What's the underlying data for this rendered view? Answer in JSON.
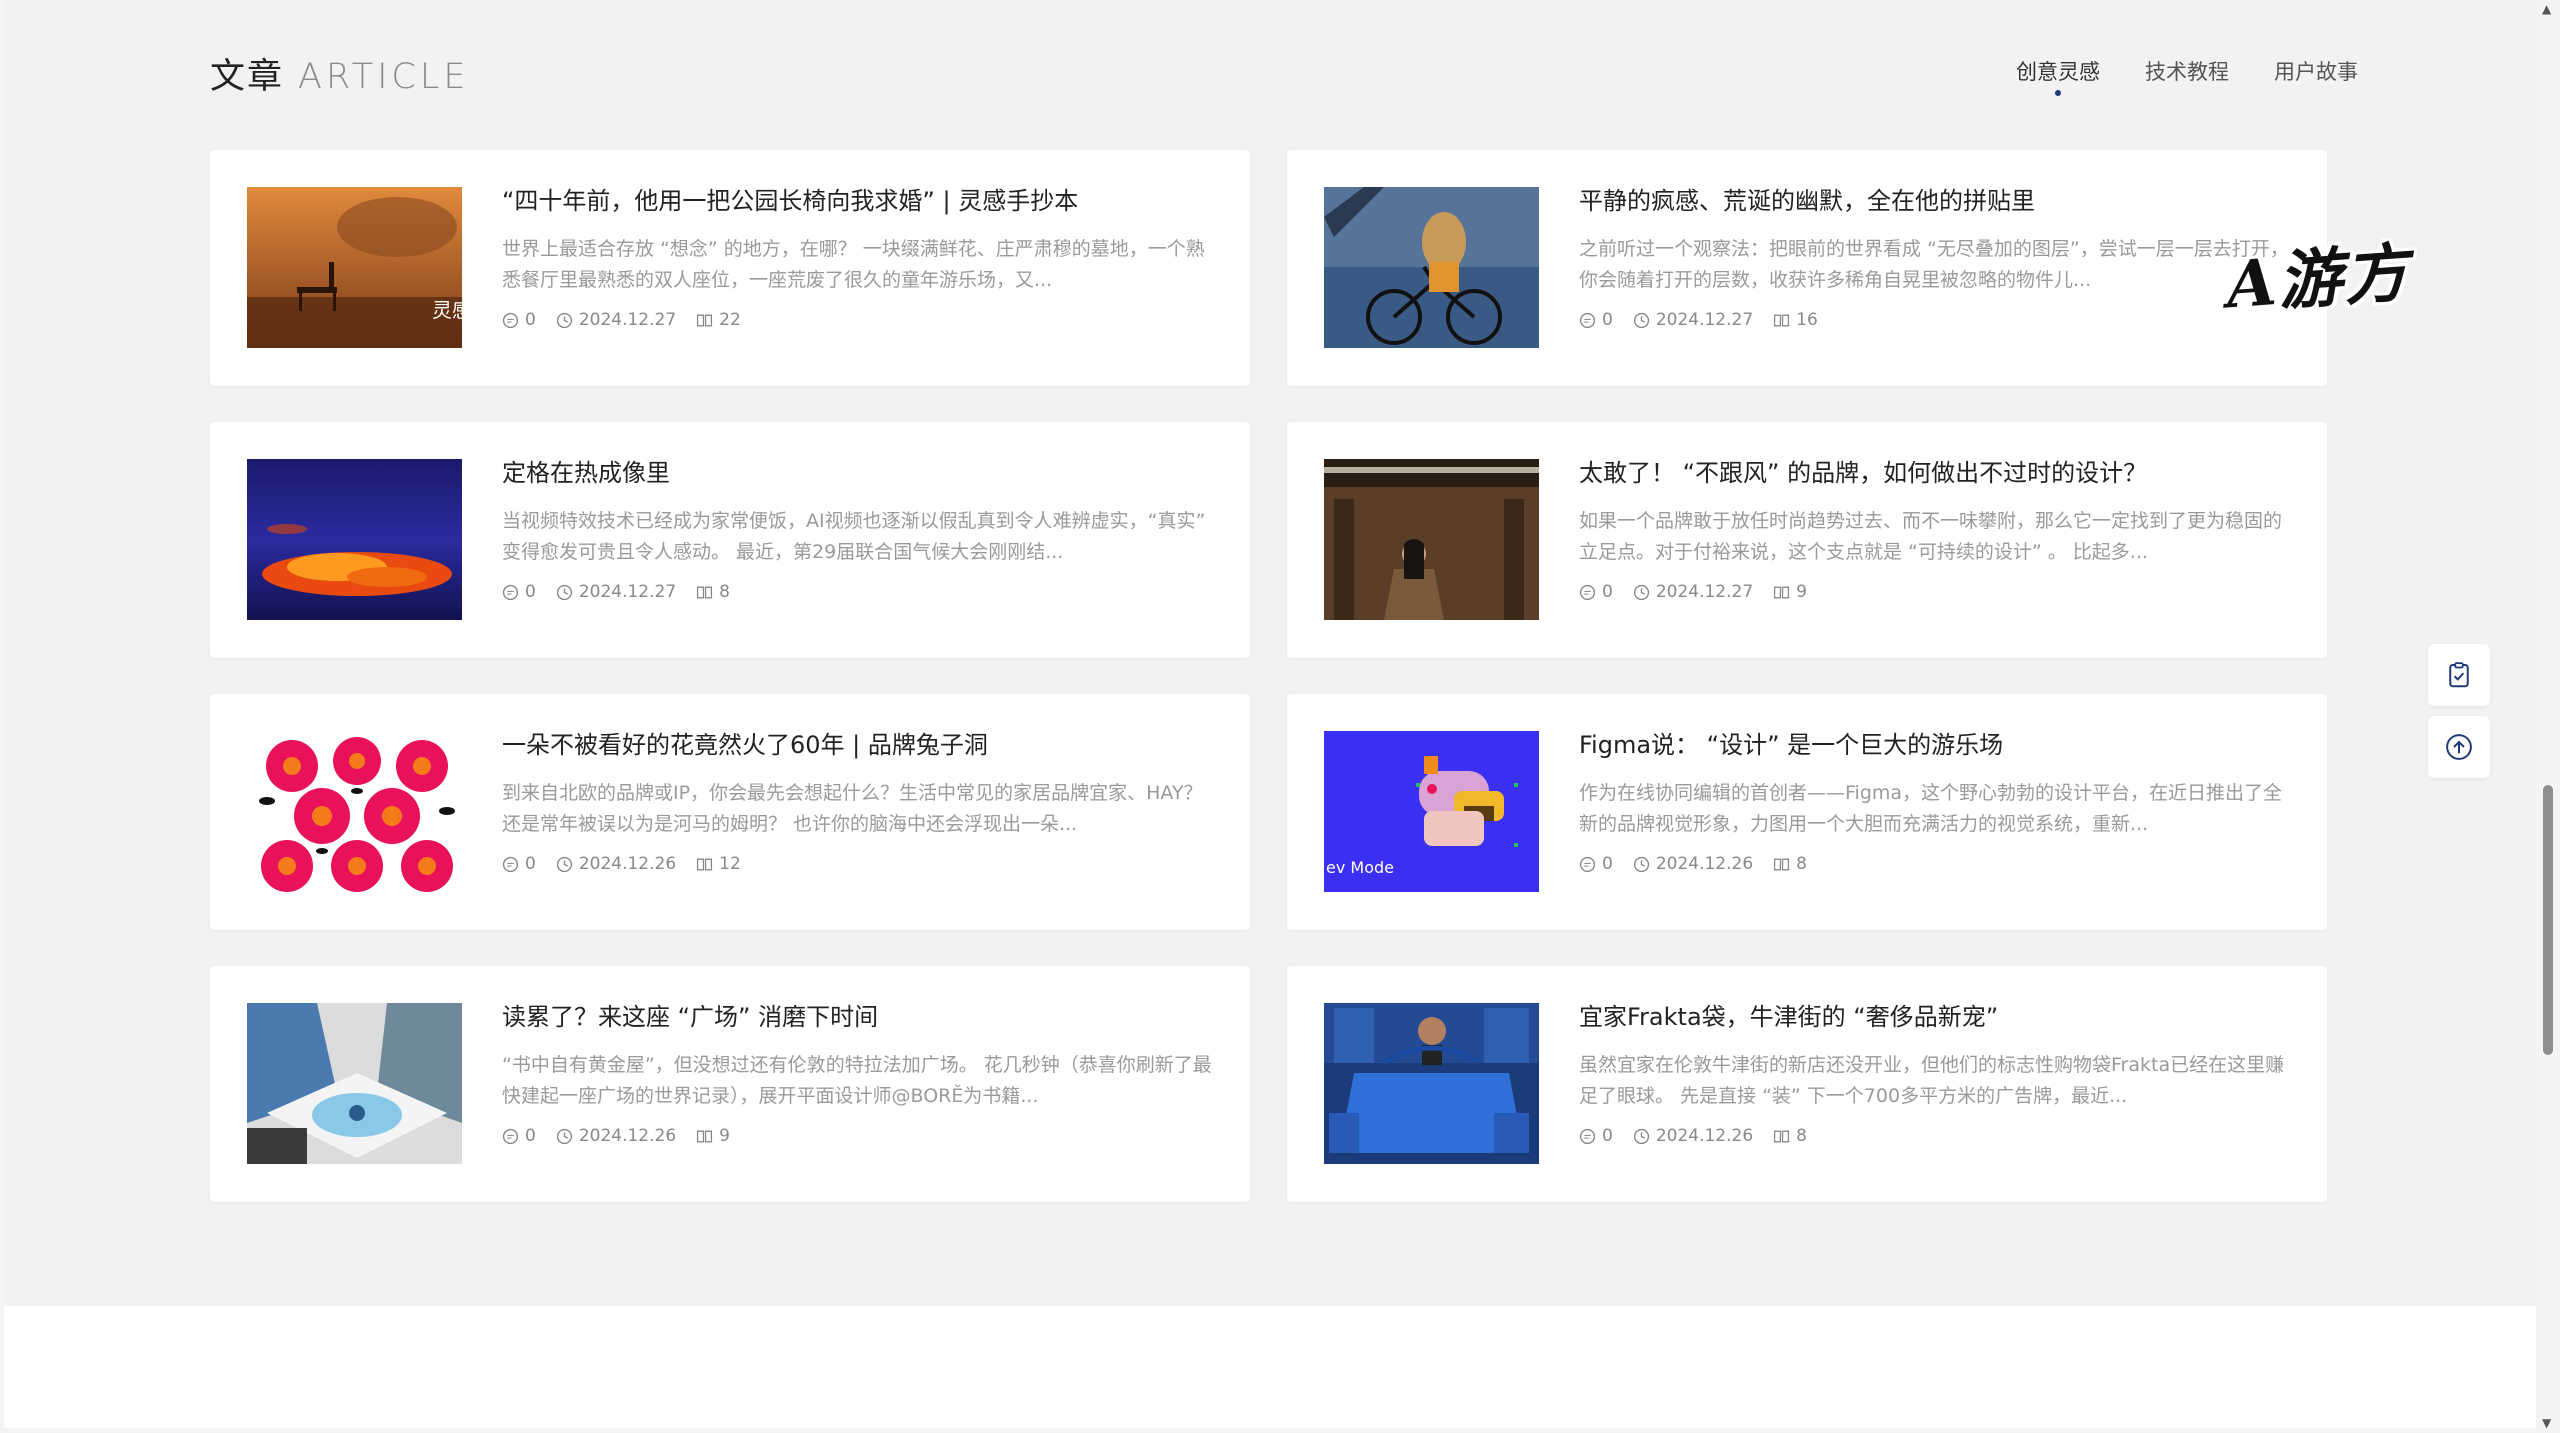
{
  "header": {
    "title_cn": "文章",
    "title_en": "ARTICLE",
    "tabs": [
      {
        "label": "创意灵感",
        "active": true
      },
      {
        "label": "技术教程",
        "active": false
      },
      {
        "label": "用户故事",
        "active": false
      }
    ]
  },
  "articles": [
    {
      "title": "“四十年前，他用一把公园长椅向我求婚” | 灵感手抄本",
      "excerpt": "世界上最适合存放 “想念” 的地方，在哪？ 一块缀满鲜花、庄严肃穆的墓地，一个熟悉餐厅里最熟悉的双人座位，一座荒废了很久的童年游乐场，又...",
      "comments": "0",
      "date": "2024.12.27",
      "views": "22",
      "thumb_text": "灵感"
    },
    {
      "title": "平静的疯感、荒诞的幽默，全在他的拼贴里",
      "excerpt": "之前听过一个观察法：把眼前的世界看成 “无尽叠加的图层”，尝试一层一层去打开，你会随着打开的层数，收获许多稀角自晃里被忽略的物件儿...",
      "comments": "0",
      "date": "2024.12.27",
      "views": "16"
    },
    {
      "title": "定格在热成像里",
      "excerpt": "当视频特效技术已经成为家常便饭，AI视频也逐渐以假乱真到令人难辨虚实，“真实” 变得愈发可贵且令人感动。 最近，第29届联合国气候大会刚刚结...",
      "comments": "0",
      "date": "2024.12.27",
      "views": "8"
    },
    {
      "title": "太敢了！ “不跟风” 的品牌，如何做出不过时的设计？",
      "excerpt": "如果一个品牌敢于放任时尚趋势过去、而不一味攀附，那么它一定找到了更为稳固的立足点。对于付裕来说，这个支点就是 “可持续的设计” 。 比起多...",
      "comments": "0",
      "date": "2024.12.27",
      "views": "9"
    },
    {
      "title": "一朵不被看好的花竟然火了60年 | 品牌兔子洞",
      "excerpt": "到来自北欧的品牌或IP，你会最先会想起什么？生活中常见的家居品牌宜家、HAY？还是常年被误以为是河马的姆明？ 也许你的脑海中还会浮现出一朵...",
      "comments": "0",
      "date": "2024.12.26",
      "views": "12"
    },
    {
      "title": "Figma说： “设计” 是一个巨大的游乐场",
      "excerpt": "作为在线协同编辑的首创者——Figma，这个野心勃勃的设计平台，在近日推出了全新的品牌视觉形象，力图用一个大胆而充满活力的视觉系统，重新...",
      "comments": "0",
      "date": "2024.12.26",
      "views": "8",
      "thumb_text": "ev Mode"
    },
    {
      "title": "读累了？来这座 “广场” 消磨下时间",
      "excerpt": "“书中自有黄金屋”，但没想过还有伦敦的特拉法加广场。 花几秒钟（恭喜你刷新了最快建起一座广场的世界记录），展开平面设计师@BORĚ为书籍...",
      "comments": "0",
      "date": "2024.12.26",
      "views": "9"
    },
    {
      "title": "宜家Frakta袋，牛津街的 “奢侈品新宠”",
      "excerpt": "虽然宜家在伦敦牛津街的新店还没开业，但他们的标志性购物袋Frakta已经在这里赚足了眼球。 先是直接 “装” 下一个700多平方米的广告牌，最近...",
      "comments": "0",
      "date": "2024.12.26",
      "views": "8"
    }
  ],
  "watermark": "A游方",
  "icons": {
    "comment": "comment-icon",
    "clock": "clock-icon",
    "book": "book-icon",
    "clipboard": "clipboard-check-icon",
    "top": "arrow-up-circle-icon"
  },
  "colors": {
    "accent": "#1e3a78",
    "background": "#f2f2f2",
    "card": "#ffffff"
  }
}
